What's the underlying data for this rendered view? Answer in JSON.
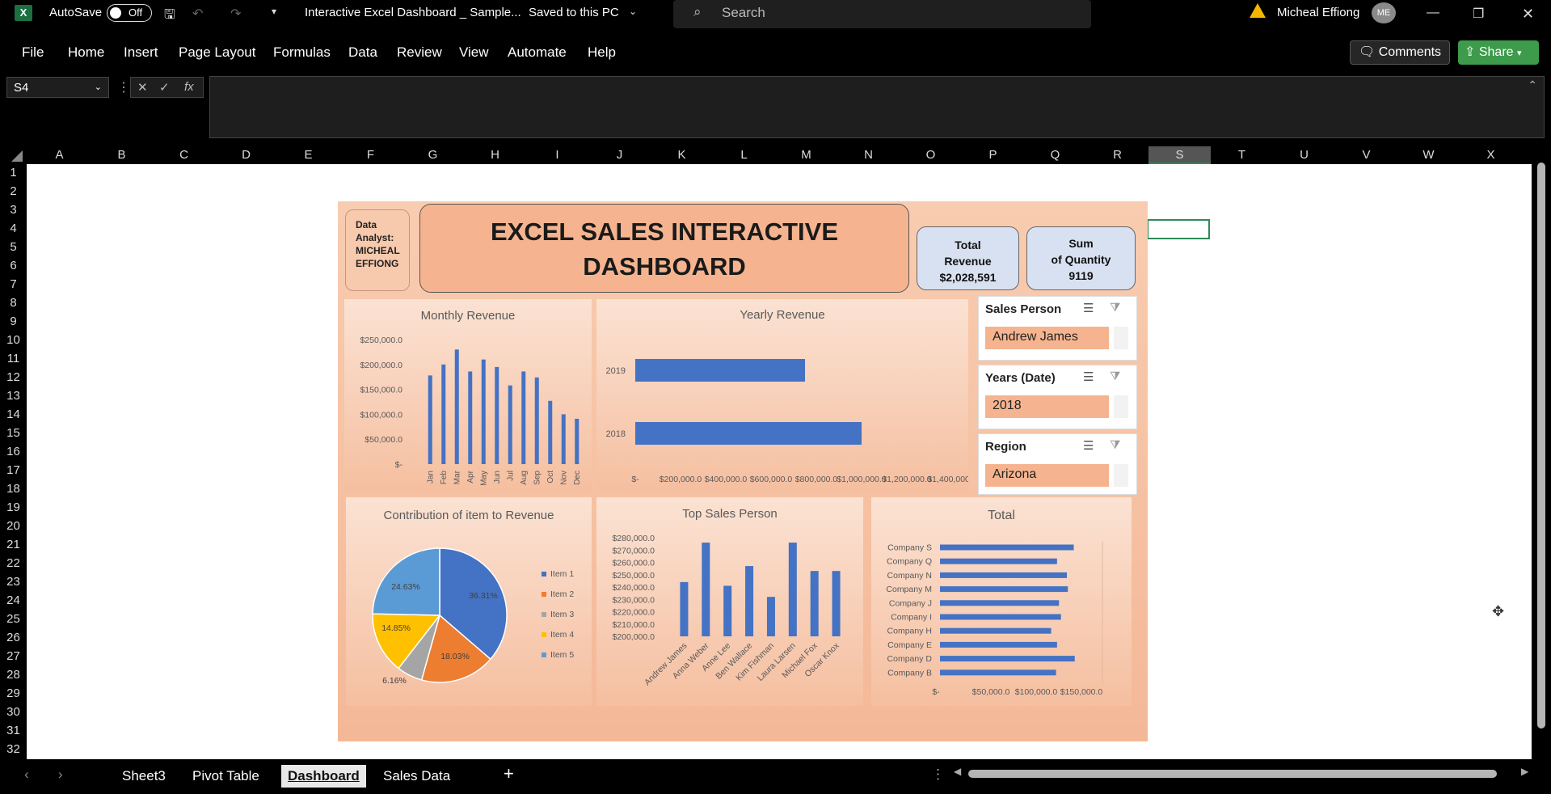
{
  "titlebar": {
    "autosave_label": "AutoSave",
    "autosave_state": "Off",
    "doc_title": "Interactive Excel Dashboard _ Sample...",
    "save_status": "Saved to this PC",
    "search_placeholder": "Search",
    "user_name": "Micheal Effiong",
    "user_initials": "ME"
  },
  "menu": [
    "File",
    "Home",
    "Insert",
    "Page Layout",
    "Formulas",
    "Data",
    "Review",
    "View",
    "Automate",
    "Help"
  ],
  "comments_label": "Comments",
  "share_label": "Share",
  "namebox": "S4",
  "fx_label": "fx",
  "columns": [
    "A",
    "B",
    "C",
    "D",
    "E",
    "F",
    "G",
    "H",
    "I",
    "J",
    "K",
    "L",
    "M",
    "N",
    "O",
    "P",
    "Q",
    "R",
    "S",
    "T",
    "U",
    "V",
    "W",
    "X"
  ],
  "selected_column": "S",
  "rows": [
    "1",
    "2",
    "3",
    "4",
    "5",
    "6",
    "7",
    "8",
    "9",
    "10",
    "11",
    "12",
    "13",
    "14",
    "15",
    "16",
    "17",
    "18",
    "19",
    "20",
    "21",
    "22",
    "23",
    "24",
    "25",
    "26",
    "27",
    "28",
    "29",
    "30",
    "31",
    "32"
  ],
  "dashboard": {
    "analyst": [
      "Data",
      "Analyst:",
      "MICHEAL",
      "EFFIONG"
    ],
    "title_line1": "EXCEL SALES INTERACTIVE",
    "title_line2": "DASHBOARD",
    "kpi1": [
      "Total",
      "Revenue",
      "$2,028,591"
    ],
    "kpi2": [
      "Sum",
      "of Quantity",
      "9119"
    ]
  },
  "slicers": [
    {
      "header": "Sales Person",
      "value": "Andrew James"
    },
    {
      "header": "Years (Date)",
      "value": "2018"
    },
    {
      "header": "Region",
      "value": "Arizona"
    }
  ],
  "sheets": [
    "Sheet3",
    "Pivot Table",
    "Dashboard",
    "Sales Data"
  ],
  "active_sheet": "Dashboard",
  "chart_data": [
    {
      "type": "bar",
      "title": "Monthly Revenue",
      "categories": [
        "Jan",
        "Feb",
        "Mar",
        "Apr",
        "May",
        "Jun",
        "Jul",
        "Aug",
        "Sep",
        "Oct",
        "Nov",
        "Dec"
      ],
      "values": [
        178000,
        200000,
        230000,
        186000,
        210000,
        195000,
        158000,
        186000,
        174000,
        127000,
        100000,
        91000
      ],
      "ytick_labels": [
        "$250,000.0",
        "$200,000.0",
        "$150,000.0",
        "$100,000.0",
        "$50,000.0",
        "$-"
      ],
      "ylim": [
        0,
        250000
      ]
    },
    {
      "type": "bar",
      "orientation": "horizontal",
      "title": "Yearly Revenue",
      "categories": [
        "2019",
        "2018"
      ],
      "values": [
        750000,
        1000000
      ],
      "xtick_labels": [
        "$-",
        "$200,000.0",
        "$400,000.0",
        "$600,000.0",
        "$800,000.0",
        "$1,000,000.0",
        "$1,200,000.0",
        "$1,400,000.0"
      ],
      "xlim": [
        0,
        1400000
      ]
    },
    {
      "type": "pie",
      "title": "Contribution of item to Revenue",
      "labels": [
        "Item 1",
        "Item 2",
        "Item 3",
        "Item 4",
        "Item 5"
      ],
      "values": [
        36.31,
        18.03,
        6.16,
        14.85,
        24.63
      ],
      "data_labels": [
        "36.31%",
        "18.03%",
        "6.16%",
        "14.85%",
        "24.63%"
      ],
      "colors": [
        "#4472c4",
        "#ed7d31",
        "#a5a5a5",
        "#ffc000",
        "#5b9bd5"
      ]
    },
    {
      "type": "bar",
      "title": "Top Sales Person",
      "categories": [
        "Andrew James",
        "Anna Weber",
        "Anne Lee",
        "Ben Wallace",
        "Kim Fishman",
        "Laura Larsen",
        "Michael Fox",
        "Oscar Knox"
      ],
      "values": [
        244000,
        276000,
        241000,
        257000,
        232000,
        276000,
        253000,
        253000
      ],
      "ytick_labels": [
        "$280,000.0",
        "$270,000.0",
        "$260,000.0",
        "$250,000.0",
        "$240,000.0",
        "$230,000.0",
        "$220,000.0",
        "$210,000.0",
        "$200,000.0"
      ],
      "ylim": [
        200000,
        280000
      ]
    },
    {
      "type": "bar",
      "orientation": "horizontal",
      "title": "Total",
      "categories": [
        "Company S",
        "Company Q",
        "Company N",
        "Company M",
        "Company J",
        "Company I",
        "Company H",
        "Company E",
        "Company D",
        "Company B"
      ],
      "values": [
        136000,
        119000,
        129000,
        130000,
        121000,
        123000,
        113000,
        119000,
        137000,
        118000
      ],
      "xtick_labels": [
        "$-",
        "$50,000.0",
        "$100,000.0",
        "$150,000.0"
      ],
      "xlim": [
        0,
        175000
      ]
    }
  ]
}
